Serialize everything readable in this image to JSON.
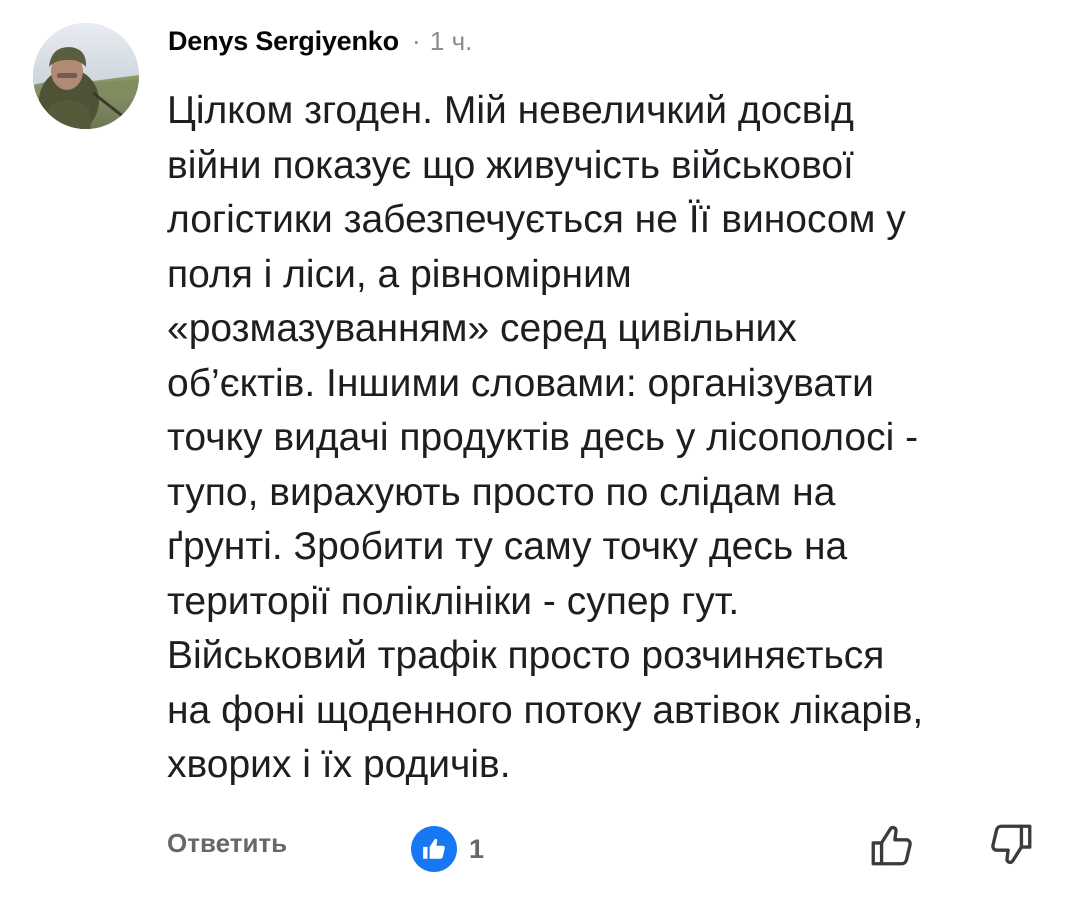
{
  "comment": {
    "author": "Denys Sergiyenko",
    "separator": "·",
    "time": "1 ч.",
    "text": "Цілком згоден. Мій невеличкий досвід\nвійни показує що живучість військової\nлогістики забезпечується не Її виносом у\nполя і ліси, а рівномірним\n«розмазуванням» серед цивільних\nоб’єктів. Іншими словами: організувати\nточку видачі продуктів десь у лісополосі -\nтупо, вирахують просто по слідам на\nґрунті. Зробити ту саму точку десь на\nтериторії поліклініки - супер гут.\nВійськовий трафік просто розчиняється\nна фоні щоденного потоку автівок лікарів,\nхворих і їх родичів."
  },
  "actions": {
    "reply_label": "Ответить",
    "like_count": "1",
    "like_icon": "thumbs-up-icon",
    "upvote_icon": "thumbs-up-outline-icon",
    "downvote_icon": "thumbs-down-outline-icon"
  },
  "colors": {
    "like_badge": "#1877f2",
    "secondary_text": "#65676b",
    "meta_text": "#8a8d91",
    "primary_text": "#1c1e21"
  }
}
